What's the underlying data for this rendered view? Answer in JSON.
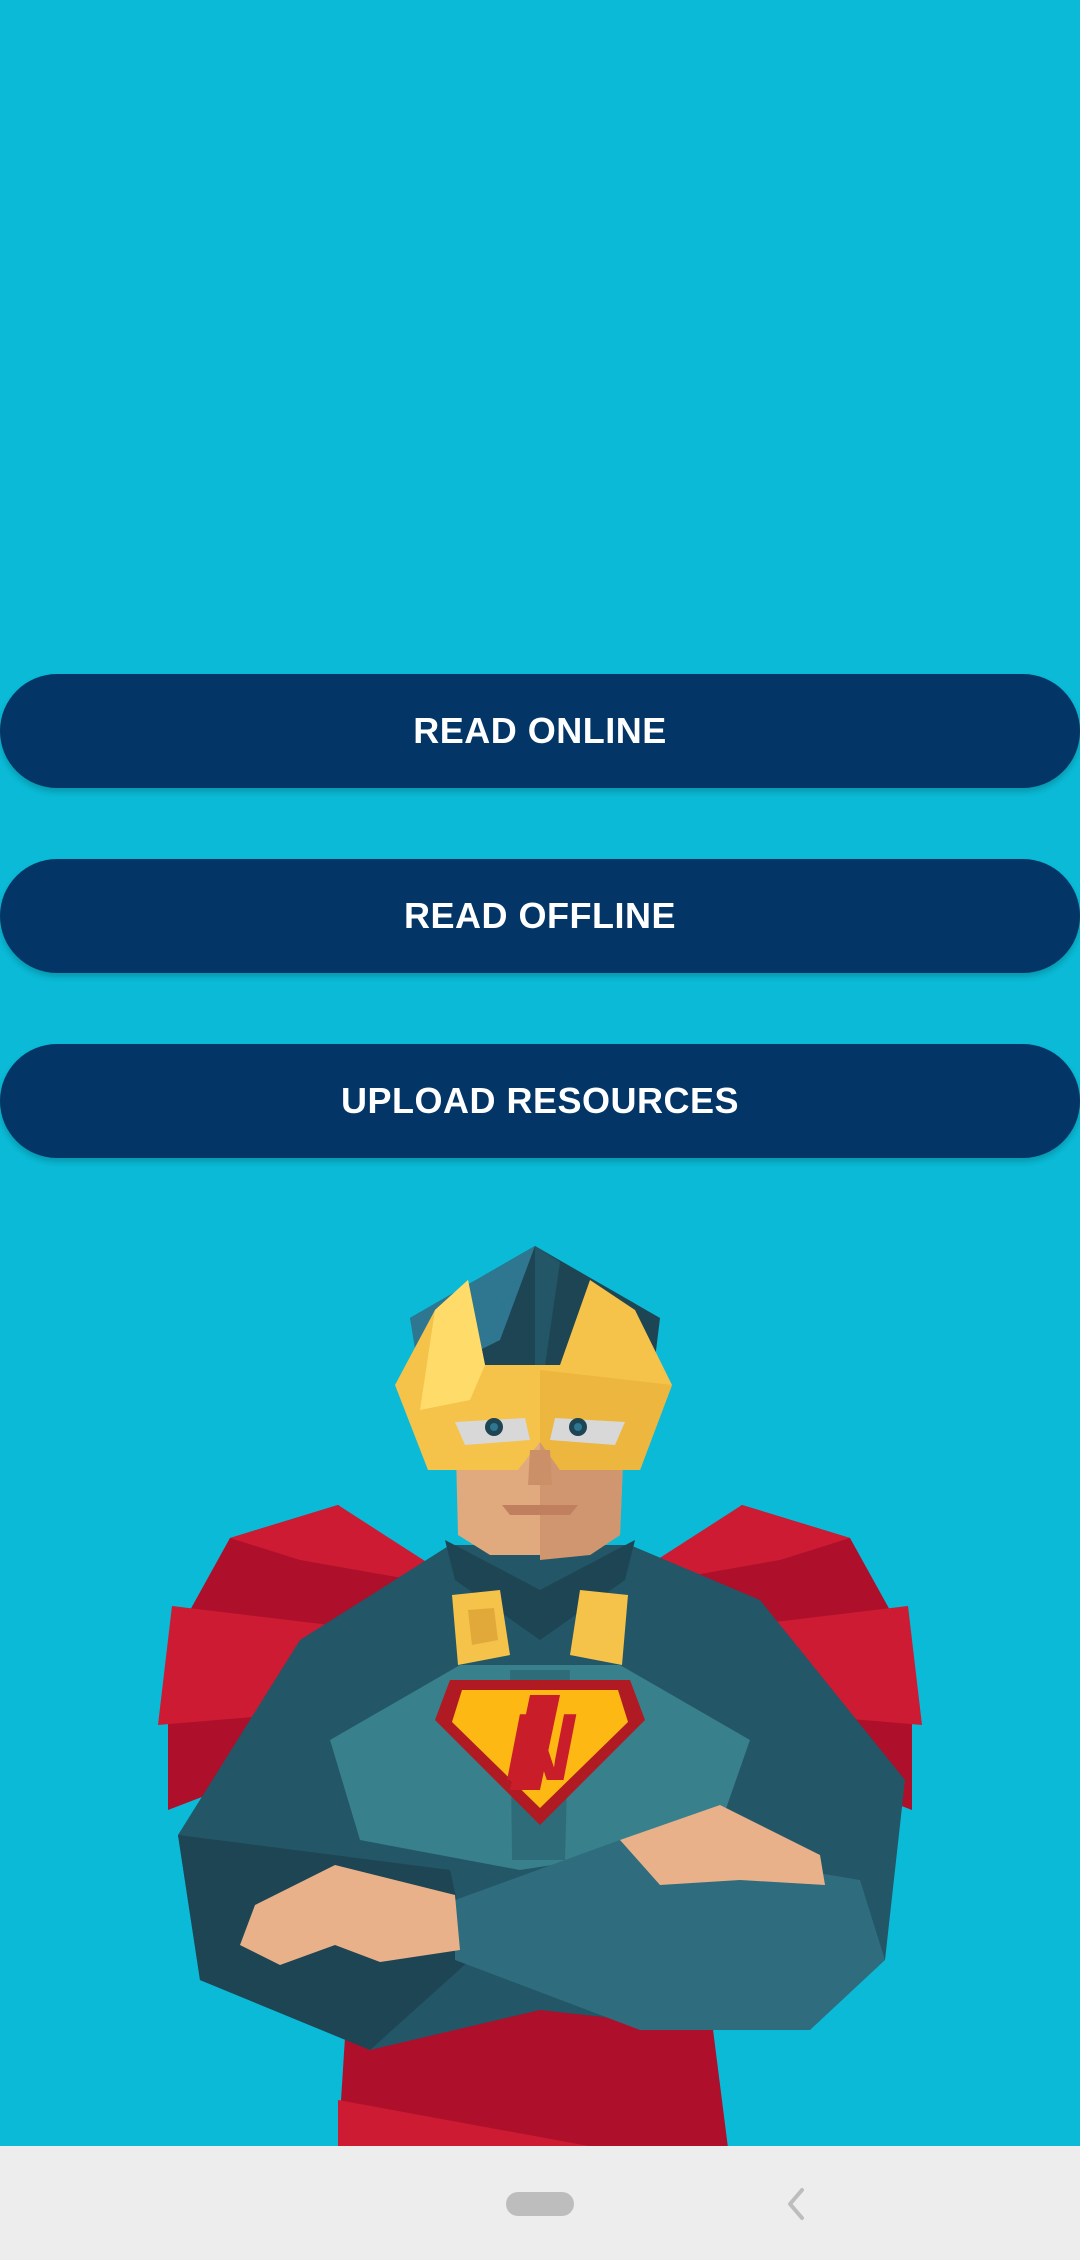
{
  "buttons": {
    "read_online": "READ ONLINE",
    "read_offline": "READ OFFLINE",
    "upload_resources": "UPLOAD RESOURCES"
  },
  "hero": {
    "emblem_letter": "N",
    "icon": "superhero-illustration"
  },
  "colors": {
    "background": "#0ABAD6",
    "button": "#033667",
    "button_text": "#FFFFFF",
    "nav_bar": "#EDEDED"
  },
  "navigation": {
    "home_icon": "home-pill-icon",
    "back_icon": "back-chevron-icon"
  }
}
